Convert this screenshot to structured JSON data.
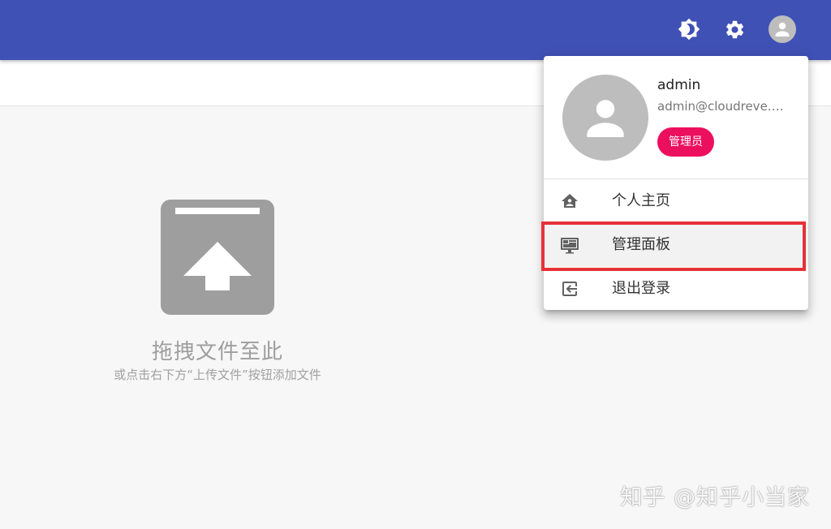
{
  "appbar": {
    "color": "#3f51b5",
    "icons": [
      "theme-toggle-icon",
      "settings-icon",
      "account-icon"
    ]
  },
  "empty_state": {
    "title": "拖拽文件至此",
    "subtitle": "或点击右下方“上传文件”按钮添加文件",
    "icon": "upload-archive-icon"
  },
  "account_menu": {
    "username": "admin",
    "email": "admin@cloudreve.org",
    "role_badge": "管理员",
    "badge_color": "#ec0f5e",
    "items": [
      {
        "label": "个人主页",
        "icon": "home-icon",
        "active": false
      },
      {
        "label": "管理面板",
        "icon": "dashboard-icon",
        "active": true
      },
      {
        "label": "退出登录",
        "icon": "logout-icon",
        "active": false
      }
    ],
    "highlight_color": "#e53238"
  },
  "watermark": "知乎 @知乎小当家"
}
